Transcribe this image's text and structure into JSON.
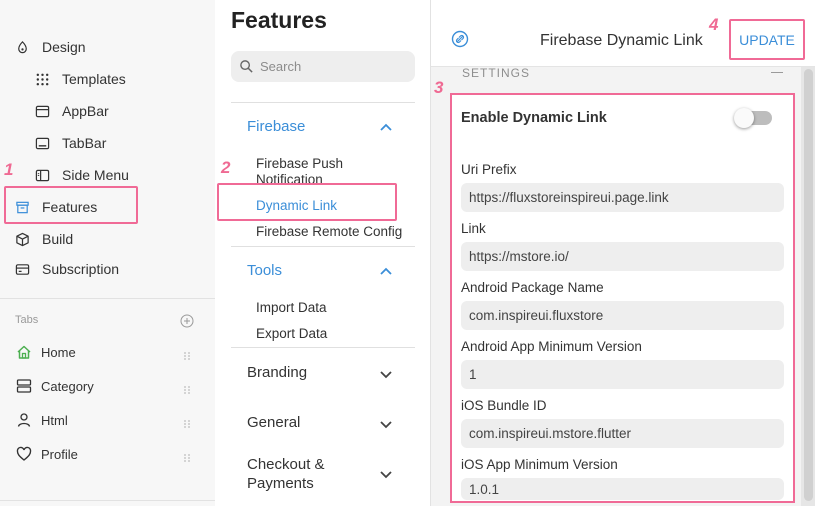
{
  "nav": {
    "items": [
      {
        "key": "design",
        "label": "Design",
        "icon": "palette-icon"
      },
      {
        "key": "templates",
        "label": "Templates",
        "icon": "grid-icon"
      },
      {
        "key": "appbar",
        "label": "AppBar",
        "icon": "appbar-icon"
      },
      {
        "key": "tabbar",
        "label": "TabBar",
        "icon": "tabbar-icon"
      },
      {
        "key": "sidemenu",
        "label": "Side Menu",
        "icon": "sidemenu-icon"
      },
      {
        "key": "features",
        "label": "Features",
        "icon": "features-icon"
      },
      {
        "key": "build",
        "label": "Build",
        "icon": "cube-icon"
      },
      {
        "key": "subscription",
        "label": "Subscription",
        "icon": "card-icon"
      }
    ],
    "tabs_heading": "Tabs",
    "tabs": [
      {
        "label": "Home",
        "icon": "home-icon"
      },
      {
        "label": "Category",
        "icon": "list-icon"
      },
      {
        "label": "Html",
        "icon": "user-icon"
      },
      {
        "label": "Profile",
        "icon": "heart-icon"
      }
    ]
  },
  "features_panel": {
    "title": "Features",
    "search_placeholder": "Search",
    "groups": {
      "firebase": {
        "label": "Firebase",
        "items": [
          "Firebase Push Notification",
          "Dynamic Link",
          "Firebase Remote Config"
        ]
      },
      "tools": {
        "label": "Tools",
        "items": [
          "Import Data",
          "Export Data"
        ]
      },
      "branding": {
        "label": "Branding"
      },
      "general": {
        "label": "General"
      },
      "checkout": {
        "label": "Checkout & Payments"
      }
    }
  },
  "detail": {
    "title": "Firebase Dynamic Link",
    "update_label": "UPDATE",
    "settings_heading": "SETTINGS",
    "enable_label": "Enable Dynamic Link",
    "enabled": false,
    "fields": [
      {
        "label": "Uri Prefix",
        "value": "https://fluxstoreinspireui.page.link"
      },
      {
        "label": "Link",
        "value": "https://mstore.io/"
      },
      {
        "label": "Android Package Name",
        "value": "com.inspireui.fluxstore"
      },
      {
        "label": "Android App Minimum Version",
        "value": "1"
      },
      {
        "label": "iOS Bundle ID",
        "value": "com.inspireui.mstore.flutter"
      },
      {
        "label": "iOS App Minimum Version",
        "value": "1.0.1"
      }
    ]
  },
  "annotations": {
    "step1": "1",
    "step2": "2",
    "step3": "3",
    "step4": "4"
  },
  "colors": {
    "accent": "#3b8ed8",
    "highlight": "#f06a96",
    "toggle_off": "#bdbdbd"
  }
}
